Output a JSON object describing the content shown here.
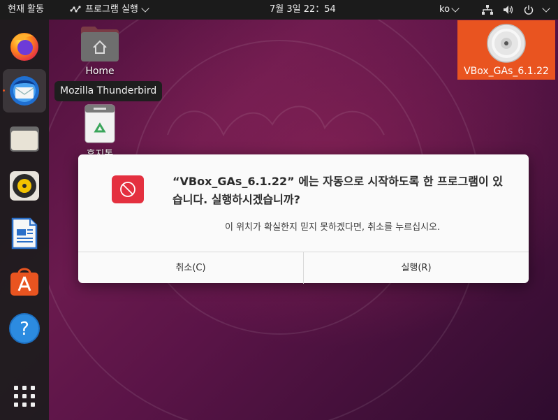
{
  "topbar": {
    "activities": "현재 활동",
    "app_menu": "프로그램 실행",
    "clock": "7월 3일  22：54",
    "language": "ko"
  },
  "dock": {
    "items": [
      {
        "name": "Firefox",
        "icon": "firefox-icon"
      },
      {
        "name": "Mozilla Thunderbird",
        "icon": "thunderbird-icon"
      },
      {
        "name": "Files",
        "icon": "files-icon"
      },
      {
        "name": "Rhythmbox",
        "icon": "rhythmbox-icon"
      },
      {
        "name": "LibreOffice Writer",
        "icon": "writer-icon"
      },
      {
        "name": "Ubuntu Software",
        "icon": "software-icon"
      },
      {
        "name": "Help",
        "icon": "help-icon"
      },
      {
        "name": "Show Applications",
        "icon": "app-grid-icon"
      }
    ]
  },
  "tooltip": "Mozilla Thunderbird",
  "desktop": {
    "home_label": "Home",
    "trash_label": "휴지통",
    "vbox_label": "VBox_GAs_6.1.22"
  },
  "dialog": {
    "title": "“VBox_GAs_6.1.22” 에는 자동으로 시작하도록 한 프로그램이 있습니다. 실행하시겠습니까?",
    "body": "이 위치가 확실한지 믿지 못하겠다면, 취소를 누르십시오.",
    "cancel_label": "취소(C)",
    "run_label": "실행(R)"
  },
  "colors": {
    "accent": "#e95420",
    "dialog_icon": "#e4303f",
    "topbar": "#1b1b1b"
  }
}
